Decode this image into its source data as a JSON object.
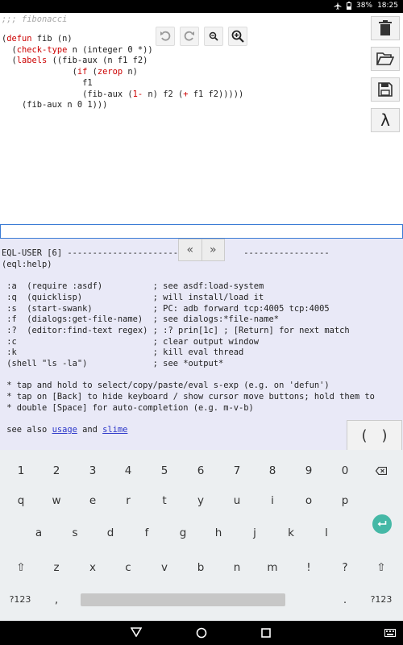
{
  "status_bar": {
    "battery": "38%",
    "time": "18:25"
  },
  "editor": {
    "comment": ";;; fibonacci",
    "code": {
      "l1_open": "(",
      "l1_kw": "defun",
      "l1_rest": " fib (n)",
      "l2_indent": "  (",
      "l2_kw": "check-type",
      "l2_rest": " n (integer 0 *))",
      "l3_indent": "  (",
      "l3_kw": "labels",
      "l3_rest": " ((fib-aux (n f1 f2)",
      "l4_indent": "              (",
      "l4_kw": "if",
      "l4_mid": " (",
      "l4_kw2": "zerop",
      "l4_rest": " n)",
      "l5": "                f1",
      "l6_a": "                (fib-aux (",
      "l6_kw": "1-",
      "l6_b": " n) f2 (",
      "l6_kw2": "+",
      "l6_c": " f1 f2)))))",
      "l7": "    (fib-aux n 0 1)))"
    }
  },
  "sidebar": {
    "lambda_label": "λ"
  },
  "repl": {
    "header": "EQL-USER [6] -----------------------            -----------------",
    "help_cmd": "(eql:help)",
    "commands": [
      " :a  (require :asdf)          ; see asdf:load-system",
      " :q  (quicklisp)              ; will install/load it",
      " :s  (start-swank)            ; PC: adb forward tcp:4005 tcp:4005",
      " :f  (dialogs:get-file-name)  ; see dialogs:*file-name*",
      " :?  (editor:find-text regex) ; :? prin[1c] ; [Return] for next match",
      " :c                           ; clear output window",
      " :k                           ; kill eval thread",
      " (shell \"ls -la\")             ; see *output*"
    ],
    "tips": [
      " * tap and hold to select/copy/paste/eval s-exp (e.g. on 'defun')",
      " * tap on [Back] to hide keyboard / show cursor move buttons; hold them to",
      " * double [Space] for auto-completion (e.g. m-v-b)"
    ],
    "see_also": " see also ",
    "link_usage": "usage",
    "and": " and ",
    "link_slime": "slime"
  },
  "arrows": {
    "left": "«",
    "right": "»"
  },
  "parens": {
    "open": "(",
    "close": ")"
  },
  "keyboard": {
    "row1": [
      "1",
      "2",
      "3",
      "4",
      "5",
      "6",
      "7",
      "8",
      "9",
      "0",
      "⌫"
    ],
    "row2": [
      "q",
      "w",
      "e",
      "r",
      "t",
      "y",
      "u",
      "i",
      "o",
      "p"
    ],
    "row3": [
      "a",
      "s",
      "d",
      "f",
      "g",
      "h",
      "j",
      "k",
      "l"
    ],
    "row4": [
      "⇧",
      "z",
      "x",
      "c",
      "v",
      "b",
      "n",
      "m",
      "!",
      "?",
      "⇧"
    ],
    "row5": [
      "?123",
      ",",
      ".",
      "?123"
    ]
  },
  "colors": {
    "accent": "#45b8a6",
    "repl_bg": "#e9e9f7",
    "keyword": "#cc0000",
    "link": "#2b36c9"
  }
}
